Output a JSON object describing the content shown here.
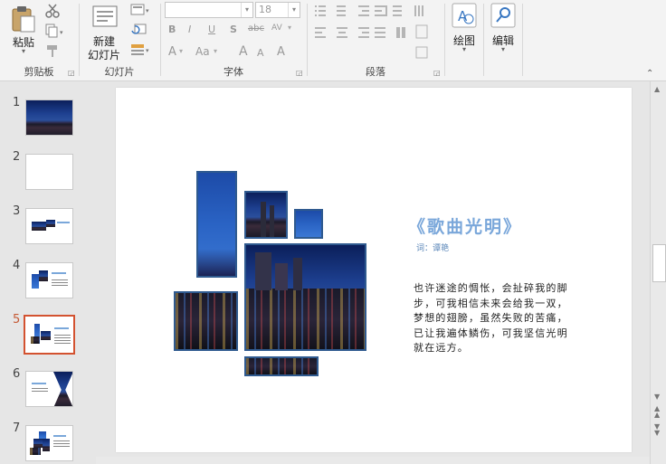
{
  "ribbon": {
    "clipboard": {
      "label": "剪贴板",
      "paste": "粘贴"
    },
    "slides": {
      "label": "幻灯片",
      "new_slide_l1": "新建",
      "new_slide_l2": "幻灯片"
    },
    "font": {
      "label": "字体",
      "font_name": "",
      "font_size": "18",
      "bold": "B",
      "italic": "I",
      "underline": "U",
      "shadow": "S",
      "strike": "abc",
      "spacing": "AV",
      "font_color": "A",
      "case": "Aa",
      "grow": "A",
      "shrink": "A",
      "clear": "A"
    },
    "paragraph": {
      "label": "段落"
    },
    "drawing": {
      "label": "绘图"
    },
    "editing": {
      "label": "编辑"
    }
  },
  "thumbnails": [
    {
      "num": "1"
    },
    {
      "num": "2"
    },
    {
      "num": "3"
    },
    {
      "num": "4"
    },
    {
      "num": "5",
      "active": true
    },
    {
      "num": "6"
    },
    {
      "num": "7"
    }
  ],
  "slide": {
    "title": "《歌曲光明》",
    "subtitle": "词：谭艳",
    "poem": "也许迷途的惆怅，会扯碎我的脚步，可我相信未来会给我一双，梦想的翅膀，虽然失败的苦痛，已让我遍体鳞伤，可我坚信光明就在远方。"
  },
  "colors": {
    "accent": "#d35230",
    "title": "#7aa7da",
    "frame": "#2f5a8f"
  }
}
